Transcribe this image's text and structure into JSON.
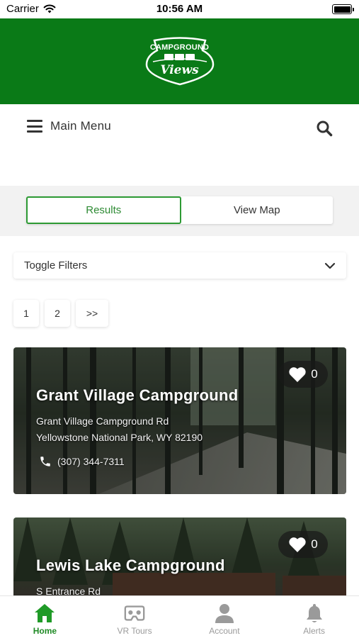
{
  "status_bar": {
    "carrier": "Carrier",
    "time": "10:56 AM"
  },
  "header": {
    "logo_top": "CAMPGROUND",
    "logo_bottom": "Views",
    "brand_color": "#0a7a17"
  },
  "nav": {
    "menu_label": "Main Menu"
  },
  "tabs": [
    {
      "label": "Results",
      "active": true
    },
    {
      "label": "View Map",
      "active": false
    }
  ],
  "filters": {
    "label": "Toggle Filters"
  },
  "pagination": {
    "pages": [
      "1",
      "2"
    ],
    "next": ">>"
  },
  "campgrounds": [
    {
      "name": "Grant Village Campground",
      "address_line1": "Grant Village Campground Rd",
      "address_line2": "Yellowstone National Park, WY 82190",
      "phone": "(307) 344-7311",
      "favorites": "0"
    },
    {
      "name": "Lewis Lake Campground",
      "address_line1": "S Entrance Rd",
      "favorites": "0"
    }
  ],
  "tab_bar": [
    {
      "label": "Home",
      "icon": "home-icon",
      "active": true
    },
    {
      "label": "VR Tours",
      "icon": "vr-headset-icon",
      "active": false
    },
    {
      "label": "Account",
      "icon": "account-icon",
      "active": false
    },
    {
      "label": "Alerts",
      "icon": "bell-icon",
      "active": false
    }
  ],
  "colors": {
    "accent": "#2d9a34",
    "tab_active": "#1f8a25",
    "tab_inactive": "#9a9a9a"
  }
}
